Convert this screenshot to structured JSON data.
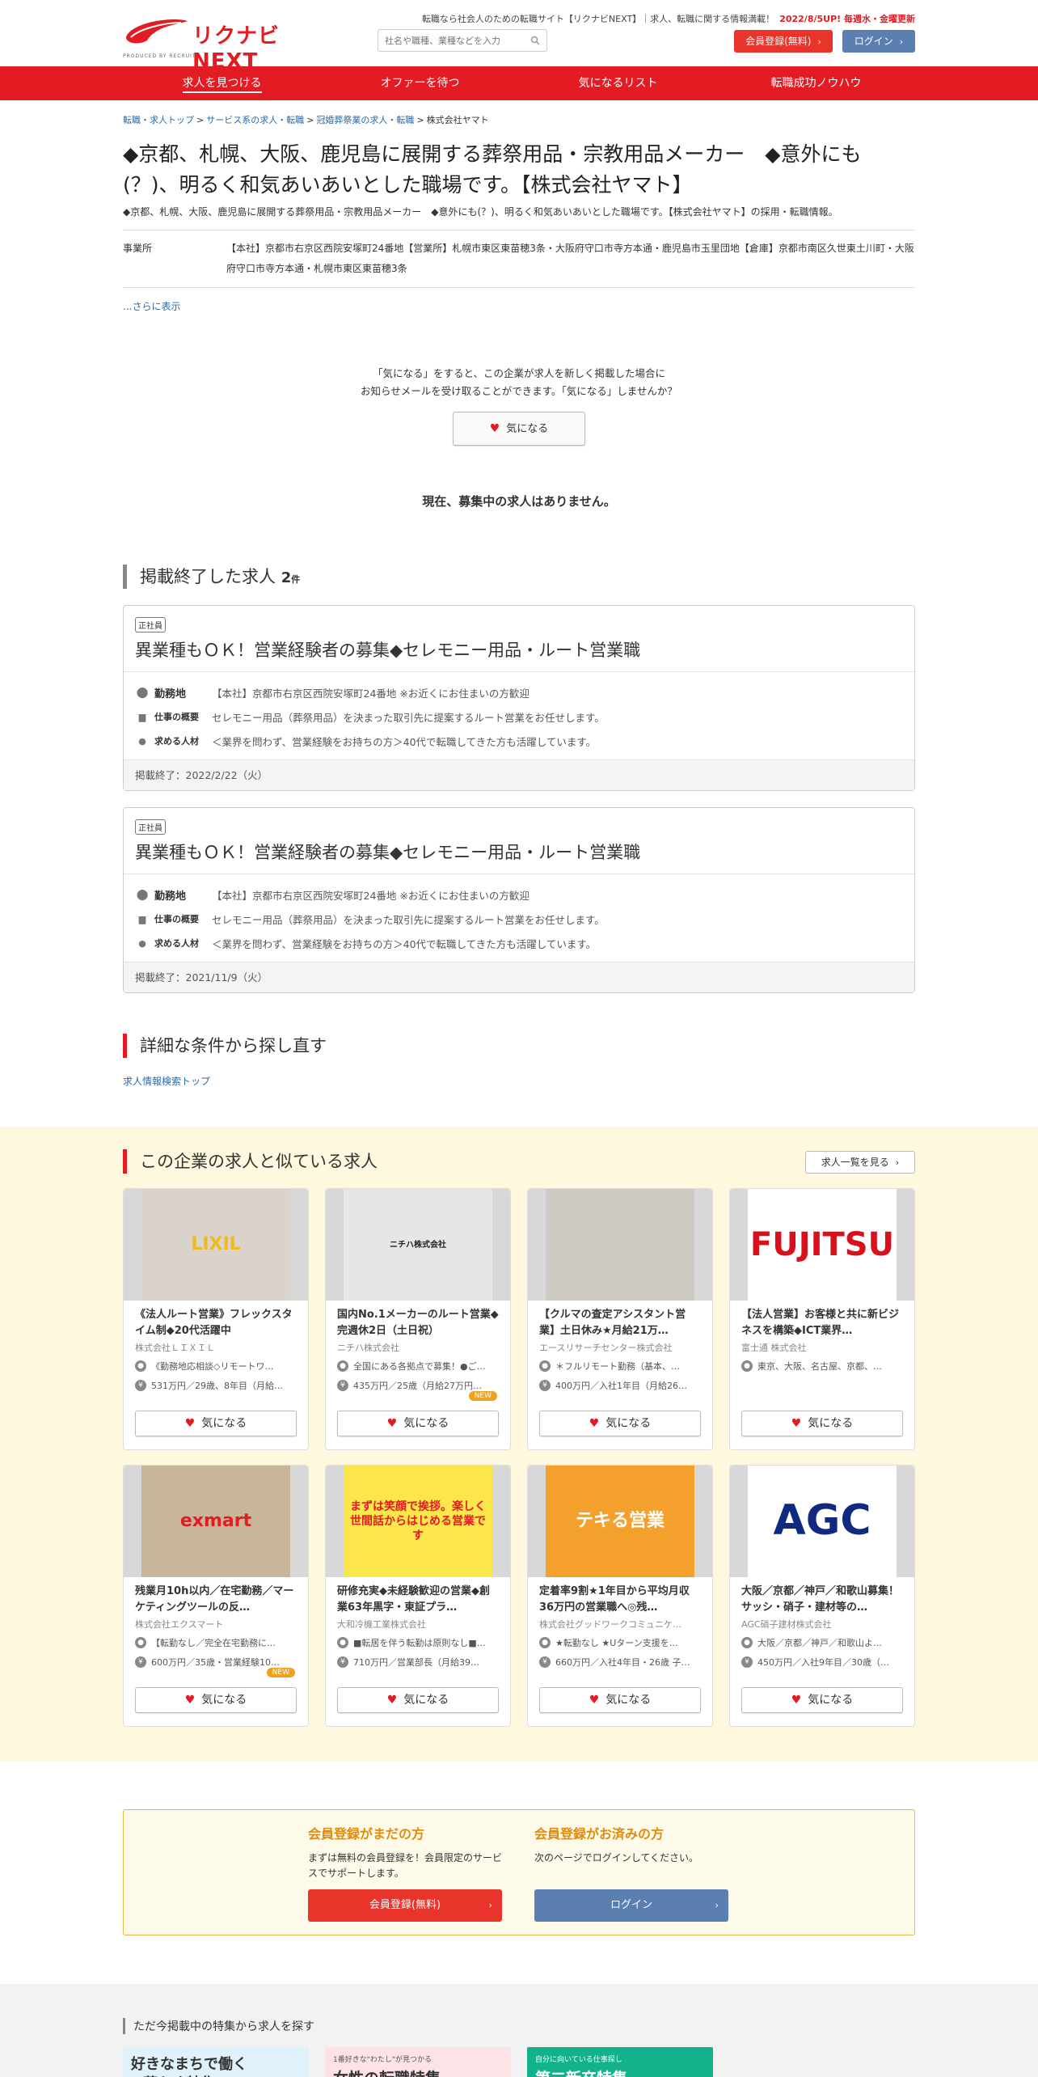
{
  "header": {
    "logo_text": "リクナビNEXT",
    "logo_sub": "PRODUCED BY RECRUIT",
    "tagline": "転職なら社会人のための転職サイト【リクナビNEXT】｜求人、転職に関する情報満載！",
    "updated": "2022/8/5UP! 毎週水・金曜更新",
    "search_placeholder": "社名や職種、業種などを入力",
    "register_label": "会員登録(無料)",
    "login_label": "ログイン"
  },
  "nav": [
    "求人を見つける",
    "オファーを待つ",
    "気になるリスト",
    "転職成功ノウハウ"
  ],
  "breadcrumb": {
    "items": [
      "転職・求人トップ",
      "サービス系の求人・転職",
      "冠婚葬祭業の求人・転職"
    ],
    "current": "株式会社ヤマト"
  },
  "company": {
    "title": "◆京都、札幌、大阪、鹿児島に展開する葬祭用品・宗教用品メーカー　◆意外にも(？)、明るく和気あいあいとした職場です。【株式会社ヤマト】",
    "lead": "◆京都、札幌、大阪、鹿児島に展開する葬祭用品・宗教用品メーカー　◆意外にも(？)、明るく和気あいあいとした職場です。【株式会社ヤマト】の採用・転職情報。",
    "office_label": "事業所",
    "office_value": "【本社】京都市右京区西院安塚町24番地【営業所】札幌市東区東苗穂3条・大阪府守口市寺方本通・鹿児島市玉里団地【倉庫】京都市南区久世東土川町・大阪府守口市寺方本通・札幌市東区東苗穂3条",
    "more_label": "...さらに表示"
  },
  "favorite": {
    "message_line1": "「気になる」をすると、この企業が求人を新しく掲載した場合に",
    "message_line2": "お知らせメールを受け取ることができます。「気になる」しませんか？",
    "button_label": "気になる",
    "no_jobs": "現在、募集中の求人はありません。"
  },
  "ended_section": {
    "title": "掲載終了した求人",
    "count": "2",
    "count_unit": "件",
    "jobs": [
      {
        "badge": "正社員",
        "title": "異業種もＯＫ！営業経験者の募集◆セレモニー用品・ルート営業職",
        "loc_label": "勤務地",
        "loc_value": "【本社】京都市右京区西院安塚町24番地 ※お近くにお住まいの方歓迎",
        "work_label": "仕事の概要",
        "work_value": "セレモニー用品（葬祭用品）を決まった取引先に提案するルート営業をお任せします。",
        "req_label": "求める人材",
        "req_value": "＜業界を問わず、営業経験をお持ちの方＞40代で転職してきた方も活躍しています。",
        "end_text": "掲載終了：2022/2/22（火）"
      },
      {
        "badge": "正社員",
        "title": "異業種もＯＫ！営業経験者の募集◆セレモニー用品・ルート営業職",
        "loc_label": "勤務地",
        "loc_value": "【本社】京都市右京区西院安塚町24番地 ※お近くにお住まいの方歓迎",
        "work_label": "仕事の概要",
        "work_value": "セレモニー用品（葬祭用品）を決まった取引先に提案するルート営業をお任せします。",
        "req_label": "求める人材",
        "req_value": "＜業界を問わず、営業経験をお持ちの方＞40代で転職してきた方も活躍しています。",
        "end_text": "掲載終了：2021/11/9（火）"
      }
    ]
  },
  "research": {
    "title": "詳細な条件から探し直す",
    "link": "求人情報検索トップ"
  },
  "similar": {
    "title": "この企業の求人と似ている求人",
    "see_all": "求人一覧を見る",
    "fav_label": "気になる",
    "new_label": "NEW",
    "cards": [
      {
        "title": "《法人ルート営業》フレックスタイム制◆20代活躍中",
        "company": "株式会社ＬＩＸＩＬ",
        "loc": "《勤務地応相談◇リモートワ…",
        "pay": "531万円／29歳、8年目（月給…",
        "new": false,
        "img": "LIXIL"
      },
      {
        "title": "国内No.1メーカーのルート営業◆完週休2日（土日祝）",
        "company": "ニチハ株式会社",
        "loc": "全国にある各拠点で募集！●ご…",
        "pay": "435万円／25歳（月給27万円…",
        "new": true,
        "img": "ニチハ株式会社"
      },
      {
        "title": "【クルマの査定アシスタント営業】土日休み★月給21万…",
        "company": "エースリサーチセンター株式会社",
        "loc": "＊フルリモート勤務（基本、…",
        "pay": "400万円／入社1年目（月給26…",
        "new": false,
        "img": ""
      },
      {
        "title": "【法人営業】お客様と共に新ビジネスを構築◆ICT業界…",
        "company": "富士通 株式会社",
        "loc": "東京、大阪、名古屋、京都、…",
        "pay": "",
        "new": false,
        "img": "FUJITSU"
      },
      {
        "title": "残業月10h以内／在宅勤務／マーケティングツールの反…",
        "company": "株式会社エクスマート",
        "loc": "【転勤なし／完全在宅勤務に…",
        "pay": "600万円／35歳・営業経験10…",
        "new": true,
        "img": "exmart"
      },
      {
        "title": "研修充実◆未経験歓迎の営業◆創業63年黒字・東証プラ…",
        "company": "大和冷機工業株式会社",
        "loc": "■転居を伴う転勤は原則なし■…",
        "pay": "710万円／営業部長（月給39…",
        "new": false,
        "img": "まずは笑顔で挨拶。楽しく世間話からはじめる営業です"
      },
      {
        "title": "定着率9割★1年目から平均月収36万円の営業職へ◎残…",
        "company": "株式会社グッドワークコミュニケ…",
        "loc": "★転勤なし ★Uターン支援を…",
        "pay": "660万円／入社4年目・26歳 子…",
        "new": false,
        "img": "テキる営業"
      },
      {
        "title": "大阪／京都／神戸／和歌山募集！サッシ・硝子・建材等の…",
        "company": "AGC硝子建材株式会社",
        "loc": "大阪／京都／神戸／和歌山よ…",
        "pay": "450万円／入社9年目／30歳（…",
        "new": false,
        "img": "AGC"
      }
    ]
  },
  "member": {
    "left_title": "会員登録がまだの方",
    "left_text": "まずは無料の会員登録を！会員限定のサービスでサポートします。",
    "left_button": "会員登録(無料)",
    "right_title": "会員登録がお済みの方",
    "right_text": "次のページでログインしてください。",
    "right_button": "ログイン"
  },
  "features": {
    "title": "ただ今掲載中の特集から求人を探す",
    "banners": [
      {
        "sub": "",
        "title": "好きなまちで働く×暮らす特集"
      },
      {
        "sub": "1番好きな\"わたし\"が見つかる",
        "title": "女性の転職特集"
      },
      {
        "sub": "自分に向いている仕事探し",
        "title": "第二新卒特集"
      }
    ]
  },
  "colors": {
    "brand_red": "#e31b23",
    "login_blue": "#5b7fb0",
    "similar_bg": "#fdf8de"
  }
}
